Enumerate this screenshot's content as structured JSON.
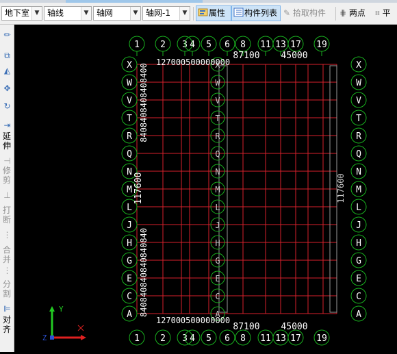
{
  "toolbar": {
    "floor_select": "地下室",
    "type_select": "轴线",
    "component_select": "轴网",
    "instance_select": "轴网-1",
    "properties_label": "属性",
    "component_list_label": "构件列表",
    "pick_component_label": "拾取构件",
    "two_points_label": "两点",
    "parallel_label": "平"
  },
  "left_toolbar": {
    "extend_label": "延伸",
    "trim_label": "修剪",
    "break_label": "打断",
    "merge_label": "合并",
    "split_label": "分割",
    "align_label": "对齐"
  },
  "grid": {
    "top_axes": [
      "1",
      "2",
      "3",
      "4",
      "5",
      "6",
      "8",
      "11",
      "13",
      "17",
      "19"
    ],
    "bottom_axes": [
      "1",
      "2",
      "3",
      "4",
      "5",
      "6",
      "8",
      "11",
      "13",
      "17",
      "19"
    ],
    "left_axes": [
      "X",
      "W",
      "V",
      "T",
      "R",
      "Q",
      "N",
      "M",
      "L",
      "J",
      "H",
      "G",
      "E",
      "C",
      "A"
    ],
    "right_axes": [
      "X",
      "W",
      "V",
      "T",
      "R",
      "Q",
      "N",
      "M",
      "L",
      "J",
      "H",
      "G",
      "E",
      "C",
      "A"
    ],
    "total_width_dim": "87100",
    "partial_width_dim": "45000",
    "top_dim_chain": "12700",
    "top_dim_chain_rest": "0500000000",
    "total_height_dim": "117600",
    "left_dim_chain": "8408408408408400",
    "left_dim_chain_bottom": "840840840840840840",
    "ucs_y_label": "Y",
    "ucs_z_label": "Z"
  },
  "colors": {
    "grid_line": "#d7212b",
    "bubble": "#19b21f",
    "dimension_text": "#ffffff",
    "background": "#000000"
  }
}
